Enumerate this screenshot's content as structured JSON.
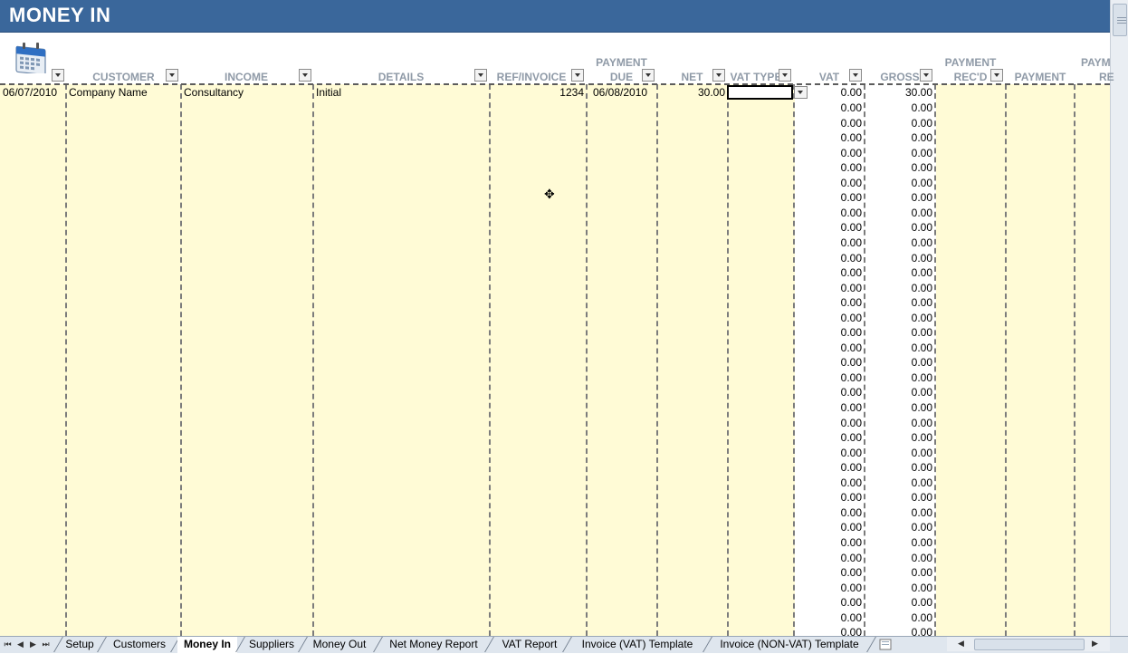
{
  "sheet_title": "MONEY IN",
  "columns": [
    {
      "id": "date",
      "label": ""
    },
    {
      "id": "customer",
      "label": "CUSTOMER"
    },
    {
      "id": "income",
      "label": "INCOME"
    },
    {
      "id": "details",
      "label": "DETAILS"
    },
    {
      "id": "ref",
      "label": "REF/INVOICE"
    },
    {
      "id": "due",
      "label_line1": "PAYMENT",
      "label_line2": "DUE"
    },
    {
      "id": "net",
      "label": "NET"
    },
    {
      "id": "vattype",
      "label": "VAT TYPE"
    },
    {
      "id": "vat",
      "label": "VAT"
    },
    {
      "id": "gross",
      "label": "GROSS"
    },
    {
      "id": "recd",
      "label_line1": "PAYMENT",
      "label_line2": "REC'D"
    },
    {
      "id": "payment",
      "label": "PAYMENT"
    },
    {
      "id": "pay2",
      "label_line1": "PAYM",
      "label_line2": "RE"
    }
  ],
  "first_row": {
    "date": "06/07/2010",
    "customer": "Company Name",
    "income": "Consultancy",
    "details": "Initial",
    "ref": "1234",
    "due": "06/08/2010",
    "net": "30.00",
    "vat": "0.00",
    "gross": "30.00"
  },
  "vat_values": [
    "0.00",
    "0.00",
    "0.00",
    "0.00",
    "0.00",
    "0.00",
    "0.00",
    "0.00",
    "0.00",
    "0.00",
    "0.00",
    "0.00",
    "0.00",
    "0.00",
    "0.00",
    "0.00",
    "0.00",
    "0.00",
    "0.00",
    "0.00",
    "0.00",
    "0.00",
    "0.00",
    "0.00",
    "0.00",
    "0.00",
    "0.00",
    "0.00",
    "0.00",
    "0.00",
    "0.00",
    "0.00",
    "0.00",
    "0.00",
    "0.00",
    "0.00"
  ],
  "gross_values": [
    "0.00",
    "0.00",
    "0.00",
    "0.00",
    "0.00",
    "0.00",
    "0.00",
    "0.00",
    "0.00",
    "0.00",
    "0.00",
    "0.00",
    "0.00",
    "0.00",
    "0.00",
    "0.00",
    "0.00",
    "0.00",
    "0.00",
    "0.00",
    "0.00",
    "0.00",
    "0.00",
    "0.00",
    "0.00",
    "0.00",
    "0.00",
    "0.00",
    "0.00",
    "0.00",
    "0.00",
    "0.00",
    "0.00",
    "0.00",
    "0.00",
    "0.00"
  ],
  "sheet_tabs": [
    "Setup",
    "Customers",
    "Money In",
    "Suppliers",
    "Money Out",
    "Net Money Report",
    "VAT Report",
    "Invoice (VAT) Template",
    "Invoice (NON-VAT) Template"
  ],
  "active_tab": "Money In",
  "colors": {
    "title_bar": "#3a679b",
    "input_cell": "#fffbd6",
    "header_text": "#8f9aa7"
  },
  "icons": {
    "calendar": "calendar-icon",
    "dropdown": "dropdown-arrow-icon",
    "cursor": "move-cursor-icon"
  }
}
